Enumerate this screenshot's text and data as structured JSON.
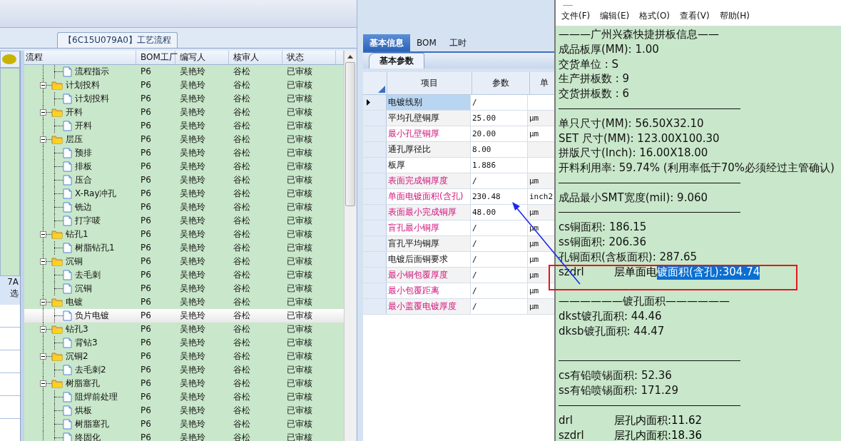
{
  "flow_window": {
    "tab_title": "【6C15U079A0】工艺流程"
  },
  "side_panel": {
    "texts": [
      "7A",
      "选"
    ]
  },
  "flow_table": {
    "columns": [
      "流程",
      "BOM工厂",
      "编写人",
      "核审人",
      "状态"
    ],
    "rows": [
      {
        "kind": "offscreen",
        "children": [
          {
            "label": "流程指示",
            "selected": false,
            "cells": [
              "P6",
              "吴艳玲",
              "谷松",
              "已审核"
            ]
          }
        ]
      },
      {
        "label": "计划投料",
        "expanded": true,
        "selected": false,
        "cells": [
          "P6",
          "吴艳玲",
          "谷松",
          "已审核"
        ],
        "children": [
          {
            "label": "计划投料",
            "selected": false,
            "cells": [
              "P6",
              "吴艳玲",
              "谷松",
              "已审核"
            ]
          }
        ]
      },
      {
        "label": "开料",
        "expanded": true,
        "selected": false,
        "cells": [
          "P6",
          "吴艳玲",
          "谷松",
          "已审核"
        ],
        "children": [
          {
            "label": "开料",
            "selected": false,
            "cells": [
              "P6",
              "吴艳玲",
              "谷松",
              "已审核"
            ]
          }
        ]
      },
      {
        "label": "层压",
        "expanded": true,
        "selected": false,
        "cells": [
          "P6",
          "吴艳玲",
          "谷松",
          "已审核"
        ],
        "children": [
          {
            "label": "预排",
            "selected": false,
            "cells": [
              "P6",
              "吴艳玲",
              "谷松",
              "已审核"
            ]
          },
          {
            "label": "排板",
            "selected": false,
            "cells": [
              "P6",
              "吴艳玲",
              "谷松",
              "已审核"
            ]
          },
          {
            "label": "压合",
            "selected": false,
            "cells": [
              "P6",
              "吴艳玲",
              "谷松",
              "已审核"
            ]
          },
          {
            "label": "X-Ray冲孔",
            "selected": false,
            "cells": [
              "P6",
              "吴艳玲",
              "谷松",
              "已审核"
            ]
          },
          {
            "label": "铣边",
            "selected": false,
            "cells": [
              "P6",
              "吴艳玲",
              "谷松",
              "已审核"
            ]
          },
          {
            "label": "打字唛",
            "selected": false,
            "cells": [
              "P6",
              "吴艳玲",
              "谷松",
              "已审核"
            ]
          }
        ]
      },
      {
        "label": "钻孔1",
        "expanded": true,
        "selected": false,
        "cells": [
          "P6",
          "吴艳玲",
          "谷松",
          "已审核"
        ],
        "children": [
          {
            "label": "树脂钻孔1",
            "selected": false,
            "cells": [
              "P6",
              "吴艳玲",
              "谷松",
              "已审核"
            ]
          }
        ]
      },
      {
        "label": "沉铜",
        "expanded": true,
        "selected": false,
        "cells": [
          "P6",
          "吴艳玲",
          "谷松",
          "已审核"
        ],
        "children": [
          {
            "label": "去毛刺",
            "selected": false,
            "cells": [
              "P6",
              "吴艳玲",
              "谷松",
              "已审核"
            ]
          },
          {
            "label": "沉铜",
            "selected": false,
            "cells": [
              "P6",
              "吴艳玲",
              "谷松",
              "已审核"
            ]
          }
        ]
      },
      {
        "label": "电镀",
        "expanded": true,
        "selected": false,
        "cells": [
          "P6",
          "吴艳玲",
          "谷松",
          "已审核"
        ],
        "children": [
          {
            "label": "负片电镀",
            "selected": true,
            "cells": [
              "P6",
              "吴艳玲",
              "谷松",
              "已审核"
            ]
          }
        ]
      },
      {
        "label": "钻孔3",
        "expanded": true,
        "selected": false,
        "cells": [
          "P6",
          "吴艳玲",
          "谷松",
          "已审核"
        ],
        "children": [
          {
            "label": "背钻3",
            "selected": false,
            "cells": [
              "P6",
              "吴艳玲",
              "谷松",
              "已审核"
            ]
          }
        ]
      },
      {
        "label": "沉铜2",
        "expanded": true,
        "selected": false,
        "cells": [
          "P6",
          "吴艳玲",
          "谷松",
          "已审核"
        ],
        "children": [
          {
            "label": "去毛刺2",
            "selected": false,
            "cells": [
              "P6",
              "吴艳玲",
              "谷松",
              "已审核"
            ]
          }
        ]
      },
      {
        "label": "树脂塞孔",
        "expanded": true,
        "selected": false,
        "cells": [
          "P6",
          "吴艳玲",
          "谷松",
          "已审核"
        ],
        "children": [
          {
            "label": "阻焊前处理",
            "selected": false,
            "cells": [
              "P6",
              "吴艳玲",
              "谷松",
              "已审核"
            ]
          },
          {
            "label": "烘板",
            "selected": false,
            "cells": [
              "P6",
              "吴艳玲",
              "谷松",
              "已审核"
            ]
          },
          {
            "label": "树脂塞孔",
            "selected": false,
            "cells": [
              "P6",
              "吴艳玲",
              "谷松",
              "已审核"
            ]
          },
          {
            "label": "终固化",
            "selected": false,
            "cells": [
              "P6",
              "吴艳玲",
              "谷松",
              "已审核"
            ]
          }
        ]
      }
    ]
  },
  "info_panel": {
    "tabs": [
      {
        "label": "基本信息",
        "selected": true
      },
      {
        "label": "BOM",
        "selected": false
      },
      {
        "label": "工时",
        "selected": false
      }
    ],
    "subtab": "基本参数",
    "columns": [
      "项目",
      "参数",
      "单"
    ],
    "rows": [
      {
        "item": "电镀线别",
        "value": "/",
        "unit": "",
        "required": false,
        "selected": true
      },
      {
        "item": "平均孔壁铜厚",
        "value": "25.00",
        "unit": "μm",
        "required": false,
        "selected": false
      },
      {
        "item": "最小孔壁铜厚",
        "value": "20.00",
        "unit": "μm",
        "required": true,
        "selected": false
      },
      {
        "item": "通孔厚径比",
        "value": "8.00",
        "unit": "",
        "required": false,
        "selected": false
      },
      {
        "item": "板厚",
        "value": "1.886",
        "unit": "",
        "required": false,
        "selected": false
      },
      {
        "item": "表面完成铜厚度",
        "value": "/",
        "unit": "μm",
        "required": true,
        "selected": false
      },
      {
        "item": "单面电镀面积(含孔)",
        "value": "230.48",
        "unit": "inch2",
        "required": true,
        "selected": false
      },
      {
        "item": "表面最小完成铜厚",
        "value": "48.00",
        "unit": "μm",
        "required": true,
        "selected": false
      },
      {
        "item": "盲孔最小铜厚",
        "value": "/",
        "unit": "μm",
        "required": true,
        "selected": false
      },
      {
        "item": "盲孔平均铜厚",
        "value": "/",
        "unit": "μm",
        "required": false,
        "selected": false
      },
      {
        "item": "电镀后面铜要求",
        "value": "/",
        "unit": "μm",
        "required": false,
        "selected": false
      },
      {
        "item": "最小铜包覆厚度",
        "value": "/",
        "unit": "μm",
        "required": true,
        "selected": false
      },
      {
        "item": "最小包覆距离",
        "value": "/",
        "unit": "μm",
        "required": true,
        "selected": false
      },
      {
        "item": "最小盖覆电镀厚度",
        "value": "/",
        "unit": "μm",
        "required": true,
        "selected": false
      }
    ]
  },
  "notepad": {
    "menu": [
      "文件(F)",
      "编辑(E)",
      "格式(O)",
      "查看(V)",
      "帮助(H)"
    ],
    "lines": [
      {
        "kind": "text",
        "text": "———广州兴森快捷拼板信息——"
      },
      {
        "kind": "text",
        "text": "成品板厚(MM): 1.00"
      },
      {
        "kind": "text",
        "text": "交货单位 : S"
      },
      {
        "kind": "text",
        "text": "生产拼板数 : 9"
      },
      {
        "kind": "text",
        "text": "交货拼板数 : 6"
      },
      {
        "kind": "rule"
      },
      {
        "kind": "text",
        "text": "单只尺寸(MM): 56.50X32.10"
      },
      {
        "kind": "text",
        "text": "SET 尺寸(MM): 123.00X100.30"
      },
      {
        "kind": "text",
        "text": "拼版尺寸(Inch): 16.00X18.00"
      },
      {
        "kind": "text",
        "text": "开料利用率: 59.74% (利用率低于70%必须经过主管确认)"
      },
      {
        "kind": "rule"
      },
      {
        "kind": "text",
        "text": "成品最小SMT宽度(mil): 9.060"
      },
      {
        "kind": "rule"
      },
      {
        "kind": "text",
        "text": "cs铜面积: 186.15"
      },
      {
        "kind": "text",
        "text": "ss铜面积: 206.36"
      },
      {
        "kind": "text",
        "text": "孔铜面积(含板面积): 287.65"
      },
      {
        "kind": "tabbed",
        "label": "szdrl",
        "text": "层单面电",
        "selection": "镀面积(含孔):304.74"
      },
      {
        "kind": "blank"
      },
      {
        "kind": "text",
        "text": "——————镀孔面积——————"
      },
      {
        "kind": "text",
        "text": "dkst镀孔面积: 44.46"
      },
      {
        "kind": "text",
        "text": "dksb镀孔面积: 44.47"
      },
      {
        "kind": "blank"
      },
      {
        "kind": "rule"
      },
      {
        "kind": "text",
        "text": "cs有铅喷锡面积: 52.36"
      },
      {
        "kind": "text",
        "text": "ss有铅喷锡面积: 171.29"
      },
      {
        "kind": "rule"
      },
      {
        "kind": "tabbed",
        "label": "drl",
        "text": "层孔内面积:11.62"
      },
      {
        "kind": "tabbed",
        "label": "szdrl",
        "text": "层孔内面积:18.36"
      }
    ]
  }
}
